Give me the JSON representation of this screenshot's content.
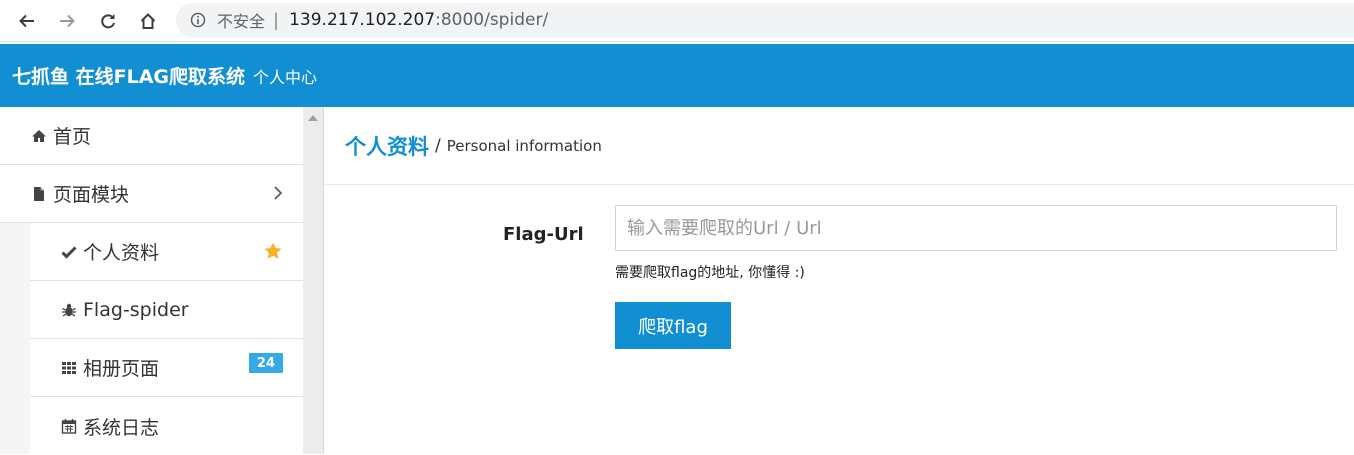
{
  "browser": {
    "security_label": "不安全",
    "separator": "|",
    "url_host": "139.217.102.207",
    "url_rest": ":8000/spider/"
  },
  "header": {
    "brand": "七抓鱼 在线FLAG爬取系统",
    "subtitle": "个人中心",
    "background_color": "#128fd2"
  },
  "sidebar": {
    "items": [
      {
        "label": "首页",
        "icon": "home-icon"
      },
      {
        "label": "页面模块",
        "icon": "file-icon",
        "chevron": "chevron-right-icon"
      },
      {
        "label": "个人资料",
        "icon": "check-icon",
        "marker": "star-icon",
        "starred": true
      },
      {
        "label": "Flag-spider",
        "icon": "bug-icon"
      },
      {
        "label": "相册页面",
        "icon": "grid-icon",
        "badge": "24"
      },
      {
        "label": "系统日志",
        "icon": "calendar-icon"
      }
    ]
  },
  "main": {
    "title": "个人资料",
    "breadcrumb_separator": "/",
    "subtitle": "Personal information",
    "form": {
      "field_label": "Flag-Url",
      "input_value": "",
      "input_placeholder": "输入需要爬取的Url / Url",
      "help_text": "需要爬取flag的地址, 你懂得 :)",
      "submit_label": "爬取flag"
    }
  },
  "colors": {
    "accent": "#128fd2",
    "badge": "#35a8e6",
    "star": "#f5b323"
  }
}
